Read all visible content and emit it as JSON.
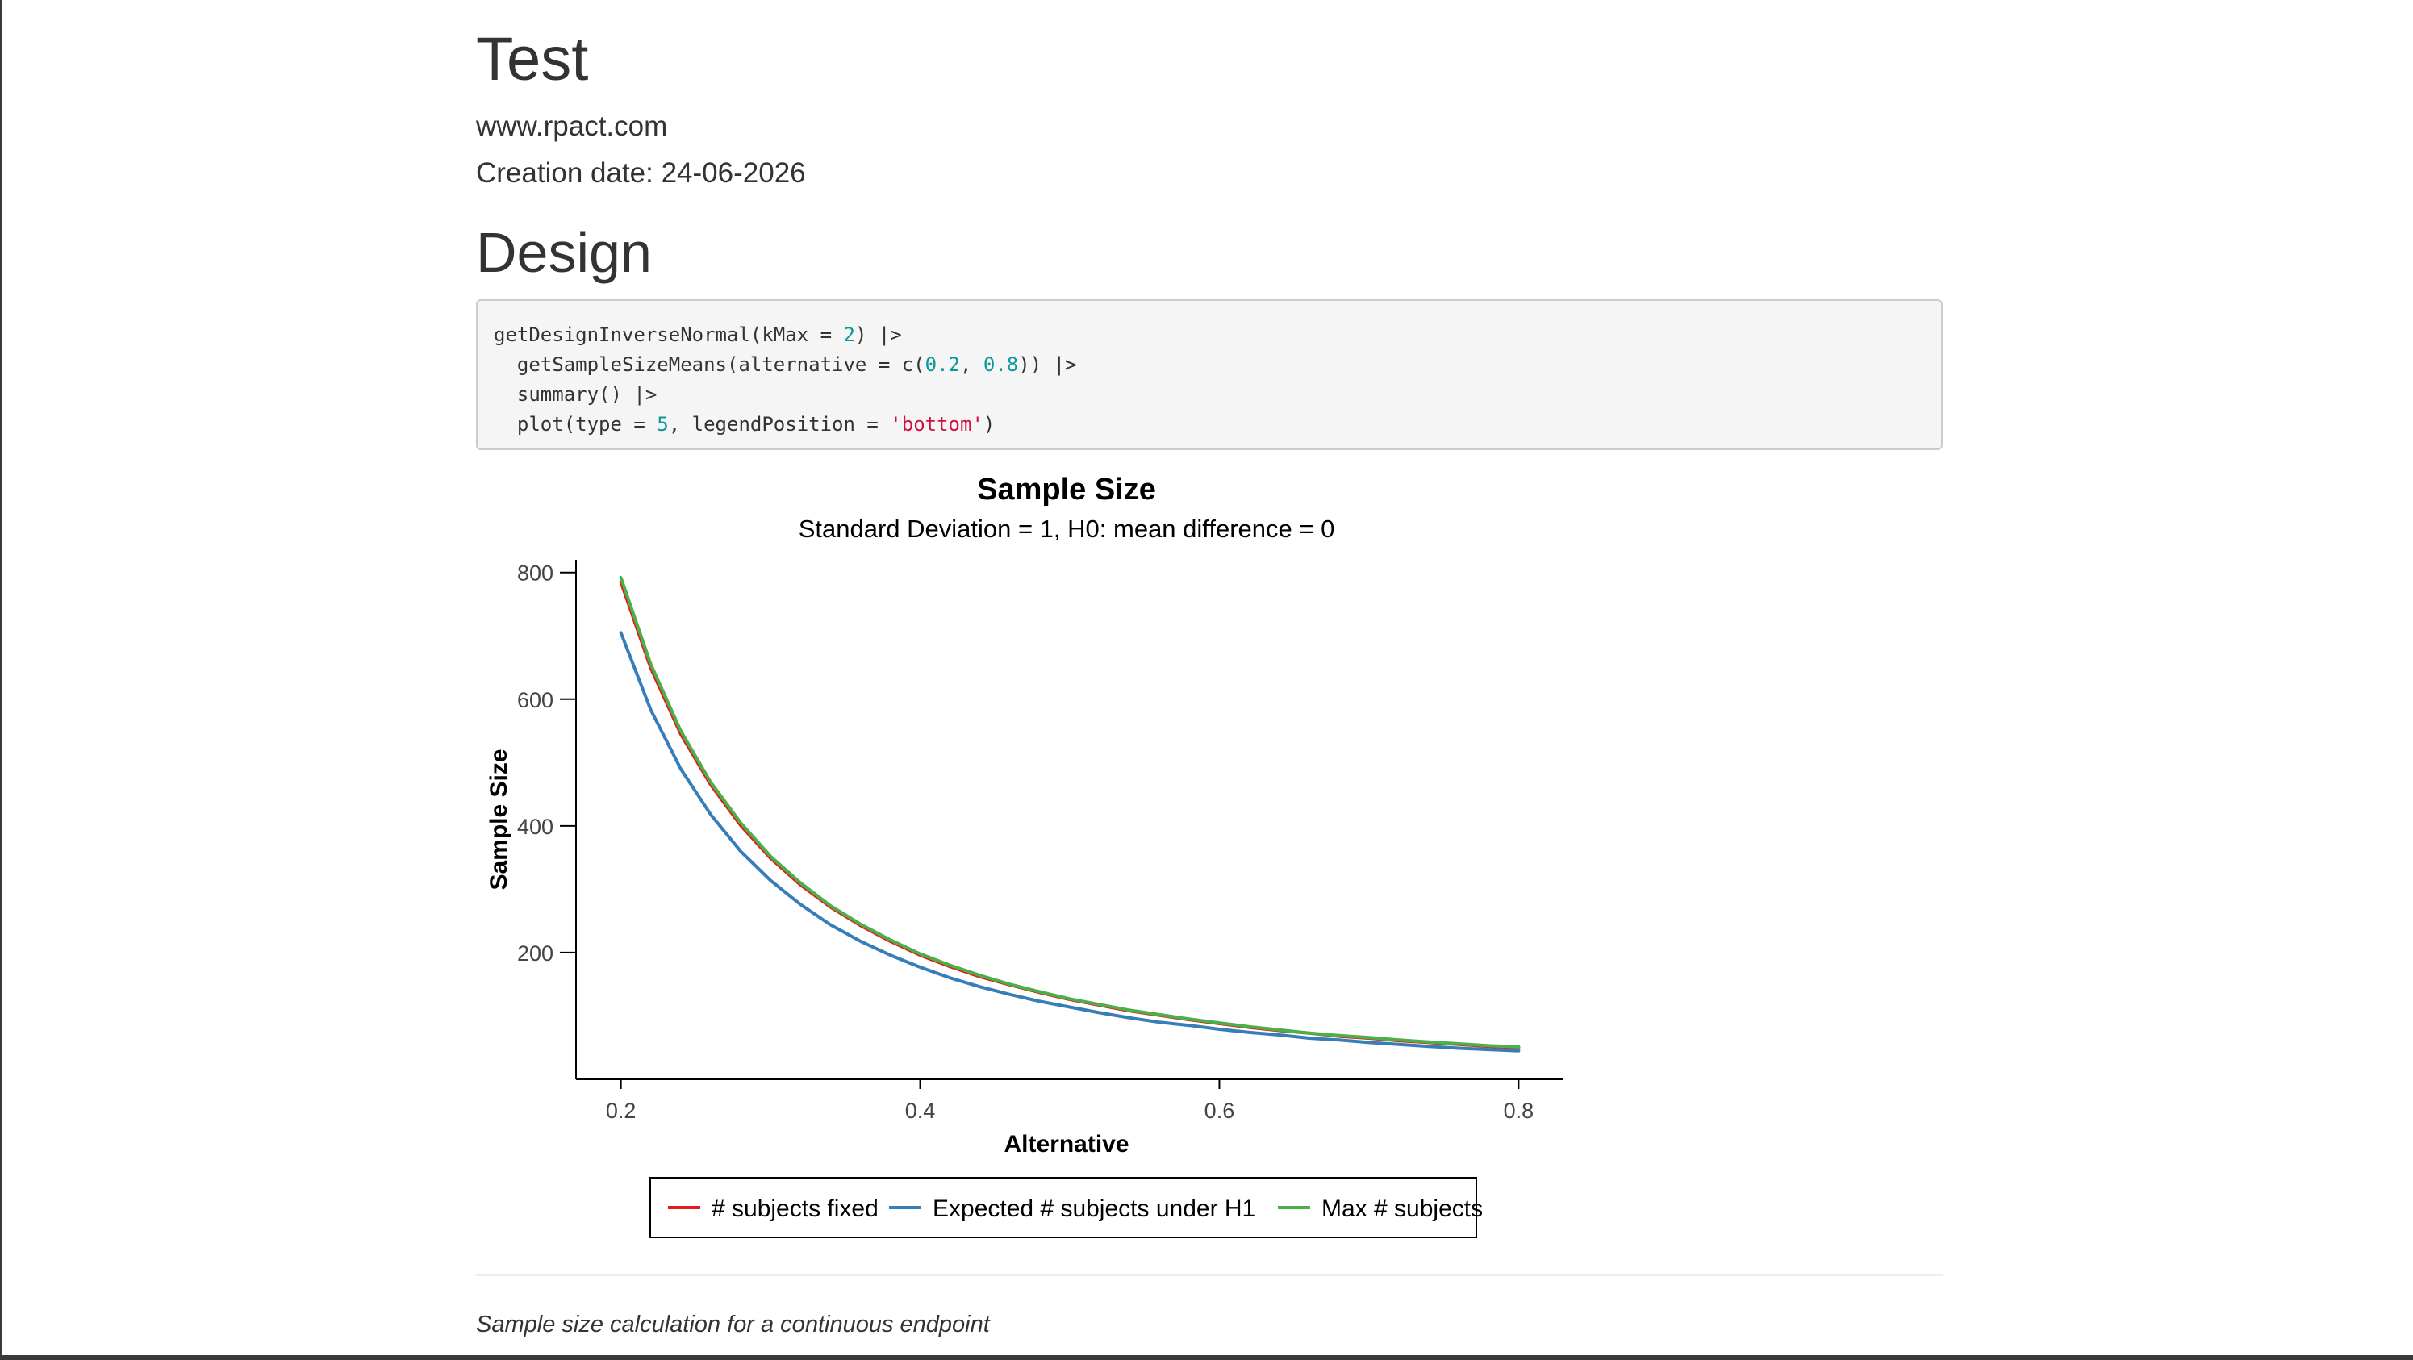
{
  "document": {
    "title": "Test",
    "author": "www.rpact.com",
    "date": "Creation date: 24-06-2026"
  },
  "section": {
    "heading": "Design"
  },
  "code": {
    "lines": [
      [
        {
          "t": "getDesignInverseNormal(kMax = ",
          "c": ""
        },
        {
          "t": "2",
          "c": "num"
        },
        {
          "t": ") |>",
          "c": ""
        }
      ],
      [
        {
          "t": "  getSampleSizeMeans(alternative = c(",
          "c": ""
        },
        {
          "t": "0.2",
          "c": "num"
        },
        {
          "t": ", ",
          "c": ""
        },
        {
          "t": "0.8",
          "c": "num"
        },
        {
          "t": ")) |>",
          "c": ""
        }
      ],
      [
        {
          "t": "  summary() |>",
          "c": ""
        }
      ],
      [
        {
          "t": "  plot(type = ",
          "c": ""
        },
        {
          "t": "5",
          "c": "num"
        },
        {
          "t": ", legendPosition = ",
          "c": ""
        },
        {
          "t": "'bottom'",
          "c": "str"
        },
        {
          "t": ")",
          "c": ""
        }
      ]
    ]
  },
  "chart_data": {
    "type": "line",
    "title": "Sample Size",
    "subtitle": "Standard Deviation = 1, H0: mean difference = 0",
    "xlabel": "Alternative",
    "ylabel": "Sample Size",
    "xlim": [
      0.17,
      0.83
    ],
    "ylim": [
      0,
      820
    ],
    "x_ticks": [
      "0.2",
      "0.4",
      "0.6",
      "0.8"
    ],
    "y_ticks": [
      "200",
      "400",
      "600",
      "800"
    ],
    "grid": false,
    "legend_position": "bottom",
    "x": [
      0.2,
      0.22,
      0.24,
      0.26,
      0.28,
      0.3,
      0.32,
      0.34,
      0.36,
      0.38,
      0.4,
      0.42,
      0.44,
      0.46,
      0.48,
      0.5,
      0.52,
      0.54,
      0.56,
      0.58,
      0.6,
      0.62,
      0.64,
      0.66,
      0.68,
      0.7,
      0.72,
      0.74,
      0.76,
      0.78,
      0.8
    ],
    "series": [
      {
        "name": "# subjects fixed",
        "color": "#e41a1c",
        "values": [
          785,
          649,
          545,
          465,
          401,
          349,
          307,
          272,
          243,
          218,
          196,
          178,
          162,
          149,
          137,
          126,
          117,
          108,
          101,
          94,
          88,
          82,
          77,
          73,
          68,
          65,
          61,
          58,
          55,
          52,
          50
        ]
      },
      {
        "name": "Expected # subjects under H1",
        "color": "#377eb8",
        "values": [
          705,
          583,
          490,
          418,
          360,
          314,
          276,
          244,
          218,
          196,
          177,
          160,
          146,
          134,
          123,
          114,
          105,
          97,
          90,
          85,
          79,
          74,
          70,
          65,
          62,
          58,
          55,
          52,
          49,
          47,
          45
        ]
      },
      {
        "name": "Max # subjects",
        "color": "#4daf4a",
        "values": [
          792,
          655,
          550,
          469,
          405,
          352,
          310,
          274,
          245,
          220,
          198,
          180,
          164,
          150,
          138,
          127,
          118,
          109,
          102,
          95,
          89,
          83,
          78,
          73,
          69,
          66,
          62,
          59,
          56,
          53,
          51
        ]
      }
    ]
  },
  "caption": "Sample size calculation for a continuous endpoint"
}
